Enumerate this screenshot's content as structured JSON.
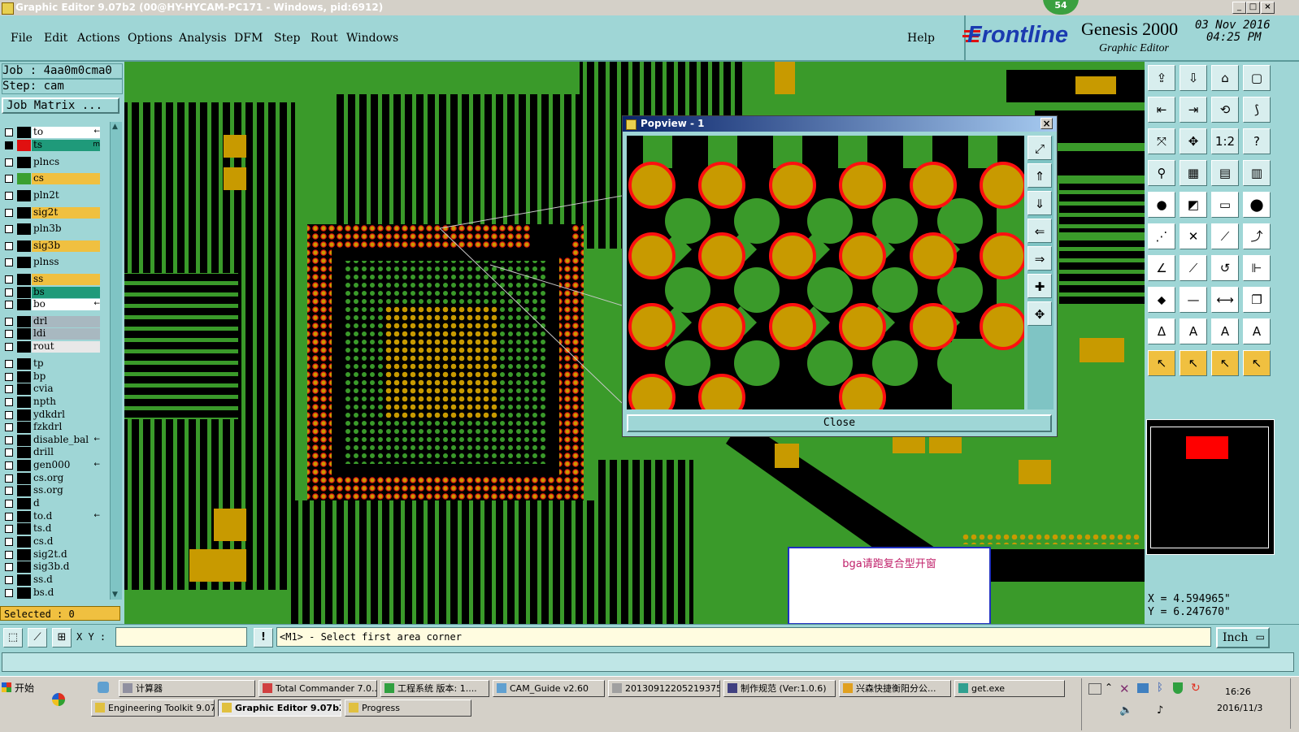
{
  "window": {
    "title": "Graphic Editor 9.07b2 (00@HY-HYCAM-PC171 - Windows, pid:6912)",
    "notification_badge": "54"
  },
  "menu": {
    "items": [
      "File",
      "Edit",
      "Actions",
      "Options",
      "Analysis",
      "DFM",
      "Step",
      "Rout",
      "Windows"
    ],
    "help": "Help"
  },
  "brand": {
    "logo": "Frontline",
    "product": "Genesis 2000",
    "subtitle": "Graphic Editor",
    "date": "03 Nov 2016",
    "time": "04:25 PM"
  },
  "job": {
    "job_line": "Job : 4aa0m0cma0",
    "step_line": "Step: cam",
    "matrix_button": "Job Matrix ...",
    "selected": "Selected : 0"
  },
  "layers": [
    {
      "name": "to",
      "color": "#ffffff",
      "swatch": "#000000",
      "flag": "←"
    },
    {
      "name": "ts",
      "color": "#1f9a7a",
      "swatch": "#e01010",
      "flag": "m",
      "active": true
    },
    {
      "name": "plncs",
      "color": "#9fd6d6",
      "swatch": "#000000"
    },
    {
      "name": "cs",
      "color": "#f0c040",
      "swatch": "#3aa030"
    },
    {
      "name": "pln2t",
      "color": "#9fd6d6",
      "swatch": "#000000"
    },
    {
      "name": "sig2t",
      "color": "#f0c040",
      "swatch": "#000000"
    },
    {
      "name": "pln3b",
      "color": "#9fd6d6",
      "swatch": "#000000"
    },
    {
      "name": "sig3b",
      "color": "#f0c040",
      "swatch": "#000000"
    },
    {
      "name": "plnss",
      "color": "#9fd6d6",
      "swatch": "#000000"
    },
    {
      "name": "ss",
      "color": "#f0c040",
      "swatch": "#000000"
    },
    {
      "name": "bs",
      "color": "#1f9a7a",
      "swatch": "#000000"
    },
    {
      "name": "bo",
      "color": "#ffffff",
      "swatch": "#000000",
      "flag": "←"
    },
    {
      "name": "drl",
      "color": "#a8b8c0",
      "swatch": "#000000"
    },
    {
      "name": "ldi",
      "color": "#a8b8c0",
      "swatch": "#000000"
    },
    {
      "name": "rout",
      "color": "#e8e8e8",
      "swatch": "#000000"
    },
    {
      "name": "tp",
      "color": "#9fd6d6",
      "swatch": "#000000"
    },
    {
      "name": "bp",
      "color": "#9fd6d6",
      "swatch": "#000000"
    },
    {
      "name": "cvia",
      "color": "#9fd6d6",
      "swatch": "#000000"
    },
    {
      "name": "npth",
      "color": "#9fd6d6",
      "swatch": "#000000"
    },
    {
      "name": "ydkdrl",
      "color": "#9fd6d6",
      "swatch": "#000000"
    },
    {
      "name": "fzkdrl",
      "color": "#9fd6d6",
      "swatch": "#000000"
    },
    {
      "name": "disable_bal",
      "color": "#9fd6d6",
      "swatch": "#000000",
      "flag": "←"
    },
    {
      "name": "drill",
      "color": "#9fd6d6",
      "swatch": "#000000"
    },
    {
      "name": "gen000",
      "color": "#9fd6d6",
      "swatch": "#000000",
      "flag": "←"
    },
    {
      "name": "cs.org",
      "color": "#9fd6d6",
      "swatch": "#000000"
    },
    {
      "name": "ss.org",
      "color": "#9fd6d6",
      "swatch": "#000000"
    },
    {
      "name": "d",
      "color": "#9fd6d6",
      "swatch": "#000000"
    },
    {
      "name": "to.d",
      "color": "#9fd6d6",
      "swatch": "#000000",
      "flag": "←"
    },
    {
      "name": "ts.d",
      "color": "#9fd6d6",
      "swatch": "#000000"
    },
    {
      "name": "cs.d",
      "color": "#9fd6d6",
      "swatch": "#000000"
    },
    {
      "name": "sig2t.d",
      "color": "#9fd6d6",
      "swatch": "#000000"
    },
    {
      "name": "sig3b.d",
      "color": "#9fd6d6",
      "swatch": "#000000"
    },
    {
      "name": "ss.d",
      "color": "#9fd6d6",
      "swatch": "#000000"
    },
    {
      "name": "bs.d",
      "color": "#9fd6d6",
      "swatch": "#000000"
    }
  ],
  "popview": {
    "title": "Popview - 1",
    "close_button": "Close"
  },
  "annotation": {
    "text": "bga请跑复合型开窗"
  },
  "coordinates": {
    "x": "X = 4.594965\"",
    "y": "Y = 6.247670\""
  },
  "command": {
    "xy_label": "X Y :",
    "xy_value": "",
    "prompt": "<M1> - Select first area corner",
    "units": "Inch"
  },
  "taskbar": {
    "start": "开始",
    "row1": [
      {
        "label": "计算器",
        "active": false
      },
      {
        "label": "Total Commander 7.0...",
        "active": false
      },
      {
        "label": "工程系统  版本: 1....",
        "active": false
      },
      {
        "label": "CAM_Guide v2.60",
        "active": false
      },
      {
        "label": "20130912205219375...",
        "active": false
      },
      {
        "label": "制作规范 (Ver:1.0.6)",
        "active": false
      },
      {
        "label": "兴森快捷衡阳分公...",
        "active": false
      },
      {
        "label": "get.exe",
        "active": false
      }
    ],
    "row2": [
      {
        "label": "Engineering Toolkit 9.07...",
        "active": false
      },
      {
        "label": "Graphic Editor 9.07b2 ...",
        "active": true
      },
      {
        "label": "Progress",
        "active": false
      }
    ],
    "clock_time": "16:26",
    "clock_date": "2016/11/3"
  },
  "colors": {
    "panel": "#9fd6d6",
    "board_green": "#3a9a2a",
    "pad_gold": "#c89a00",
    "pad_outline_red": "#ff1010",
    "canvas_bg": "#000000"
  },
  "icons": {
    "toolbar": [
      "zoom-home-icon",
      "zoom-in-icon",
      "home-icon",
      "zoom-fit-icon",
      "pan-left-icon",
      "pan-right-icon",
      "mirror-icon",
      "snap-icon",
      "zoom-area-icon",
      "zoom-center-icon",
      "ratio-icon",
      "help-icon",
      "measure-icon",
      "grid-icon",
      "layers-icon",
      "layers-multi-icon",
      "select-icon",
      "highlight-icon",
      "ruler-icon",
      "pad-icon",
      "link-icon",
      "cross-icon",
      "line-icon",
      "line-add-icon",
      "angle-icon",
      "diagonal-icon",
      "rotate-icon",
      "fit-icon",
      "move-icon",
      "break-icon",
      "stretch-icon",
      "copy-icon",
      "text-icon",
      "text-add-icon",
      "text-edit-icon",
      "text-delete-icon",
      "pointer-icon",
      "pointer-box-icon",
      "pointer-circle-icon",
      "pointer-multi-icon"
    ]
  }
}
